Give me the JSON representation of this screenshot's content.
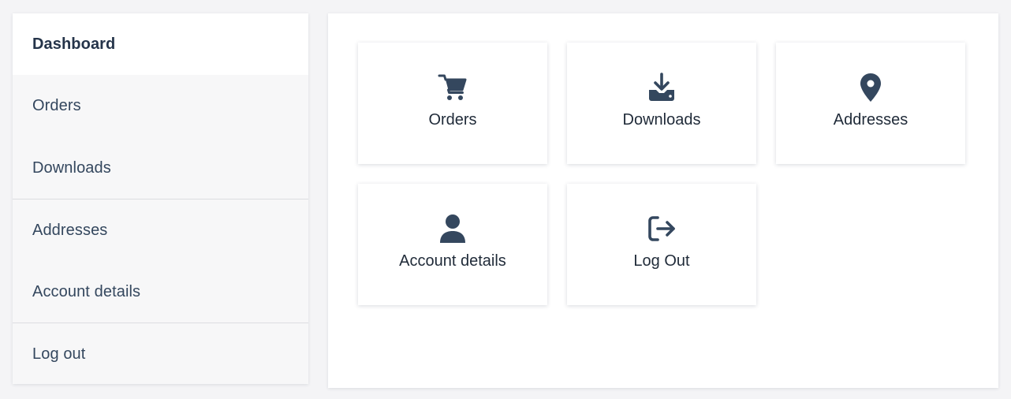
{
  "sidebar": {
    "items": [
      {
        "label": "Dashboard",
        "active": true
      },
      {
        "label": "Orders",
        "active": false
      },
      {
        "label": "Downloads",
        "active": false
      },
      {
        "label": "Addresses",
        "active": false
      },
      {
        "label": "Account details",
        "active": false
      },
      {
        "label": "Log out",
        "active": false
      }
    ]
  },
  "tiles": [
    {
      "label": "Orders",
      "icon": "cart-icon"
    },
    {
      "label": "Downloads",
      "icon": "download-icon"
    },
    {
      "label": "Addresses",
      "icon": "map-pin-icon"
    },
    {
      "label": "Account details",
      "icon": "user-icon"
    },
    {
      "label": "Log Out",
      "icon": "logout-icon"
    }
  ],
  "colors": {
    "icon": "#34475e",
    "text": "#1f2a38",
    "sidebar_bg": "#f7f7f8",
    "active_bg": "#ffffff",
    "page_bg": "#f4f4f6"
  }
}
